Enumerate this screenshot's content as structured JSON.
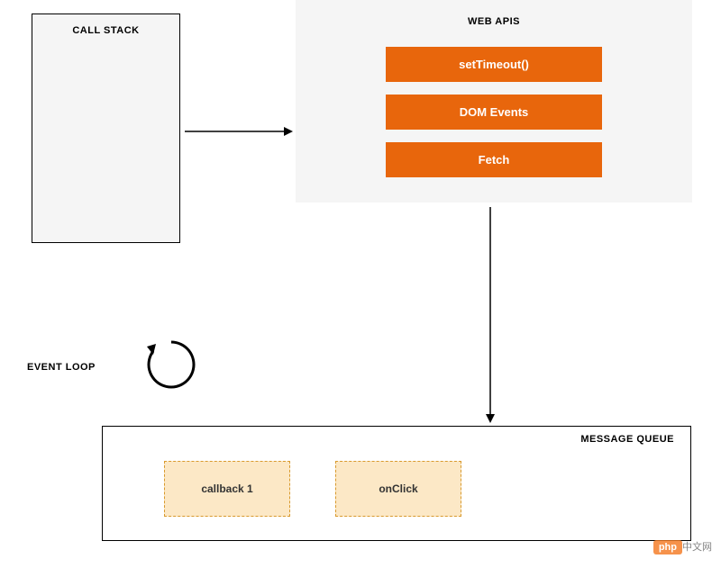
{
  "callStack": {
    "title": "CALL STACK"
  },
  "webApis": {
    "title": "WEB APIS",
    "items": [
      "setTimeout()",
      "DOM Events",
      "Fetch"
    ]
  },
  "eventLoop": {
    "label": "EVENT LOOP"
  },
  "messageQueue": {
    "title": "MESSAGE QUEUE",
    "items": [
      "callback 1",
      "onClick"
    ]
  },
  "watermark": {
    "badge": "php",
    "text": "中文网"
  },
  "colors": {
    "apiBox": "#e8660c",
    "queueItem": "#fce8c6",
    "queueBorder": "#d89a2e",
    "panel": "#f5f5f5"
  }
}
